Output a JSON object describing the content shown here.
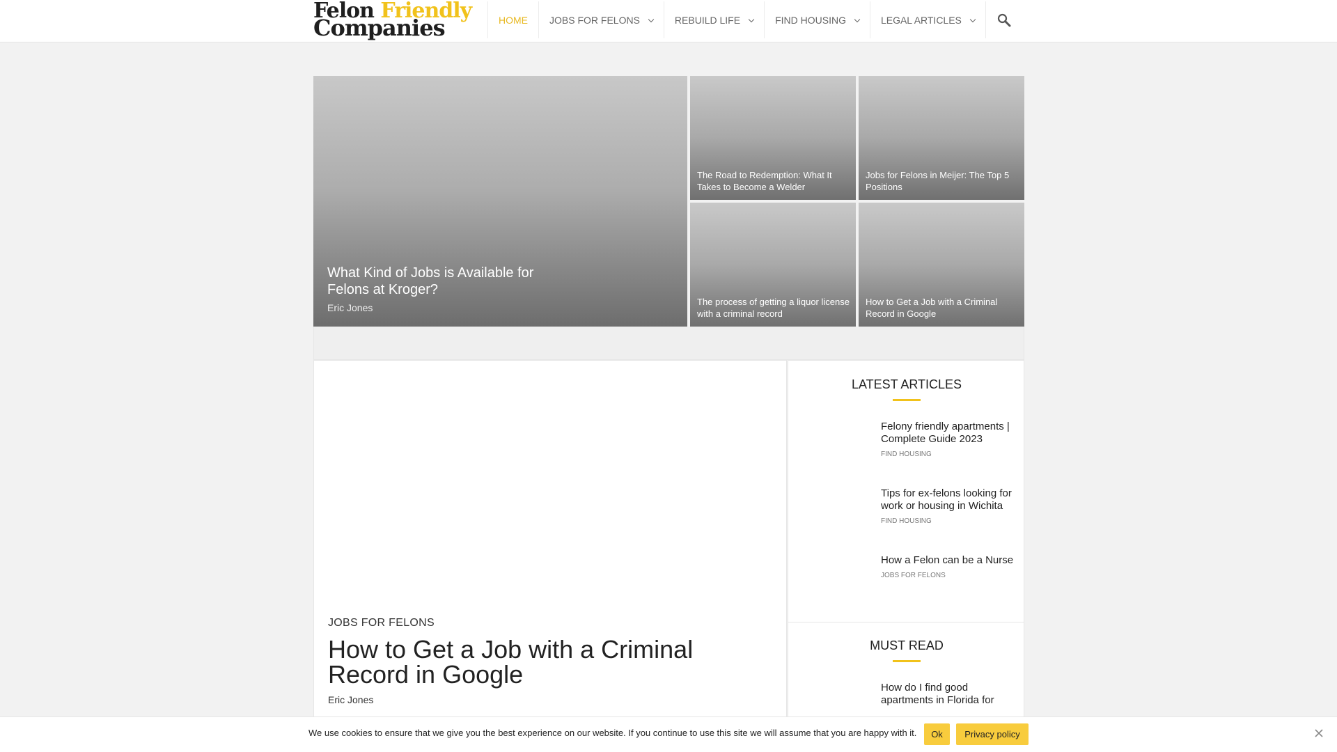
{
  "logo": {
    "line1_a": "Felon",
    "line1_b": "Friendly",
    "line2": "Companies"
  },
  "nav": {
    "items": [
      {
        "label": "HOME"
      },
      {
        "label": "JOBS FOR FELONS"
      },
      {
        "label": "REBUILD LIFE"
      },
      {
        "label": "FIND HOUSING"
      },
      {
        "label": "LEGAL ARTICLES"
      }
    ]
  },
  "hero": {
    "main": {
      "title": "What Kind of Jobs is Available for Felons at Kroger?",
      "author": "Eric Jones"
    },
    "tiles": [
      {
        "title": "The Road to Redemption: What It Takes to Become a Welder"
      },
      {
        "title": "Jobs for Felons in Meijer: The Top 5 Positions"
      },
      {
        "title": "The process of getting a liquor license with a criminal record"
      },
      {
        "title": "How to Get a Job with a Criminal Record in Google"
      }
    ]
  },
  "article": {
    "category": "JOBS FOR FELONS",
    "title": "How to Get a Job with a Criminal Record in Google",
    "author": "Eric Jones"
  },
  "sidebar": {
    "latest_title": "LATEST ARTICLES",
    "latest": [
      {
        "title": "Felony friendly apartments | Complete Guide 2023",
        "category": "FIND HOUSING"
      },
      {
        "title": "Tips for ex-felons looking for work or housing in Wichita",
        "category": "FIND HOUSING"
      },
      {
        "title": "How a Felon can be a Nurse",
        "category": "JOBS FOR FELONS"
      }
    ],
    "must_read_title": "MUST READ",
    "must_read": [
      {
        "title": "How do I find good apartments in Florida for"
      }
    ]
  },
  "cookie": {
    "message": "We use cookies to ensure that we give you the best experience on our website. If you continue to use this site we will assume that you are happy with it.",
    "ok": "Ok",
    "privacy": "Privacy policy"
  }
}
